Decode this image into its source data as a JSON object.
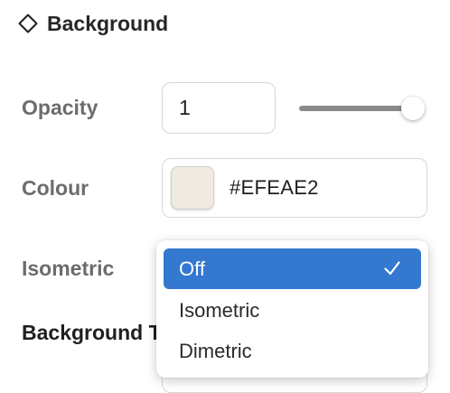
{
  "section": {
    "title": "Background",
    "icon": "diamond-outline-icon"
  },
  "opacity": {
    "label": "Opacity",
    "value": "1",
    "slider_fraction": 1.0
  },
  "colour": {
    "label": "Colour",
    "hex": "#EFEAE2",
    "swatch_color": "#EFEAE2"
  },
  "isometric": {
    "label": "Isometric",
    "selected": "Off",
    "options": [
      "Off",
      "Isometric",
      "Dimetric"
    ]
  },
  "background_type": {
    "label": "Background T"
  },
  "colors": {
    "accent": "#3478D0"
  }
}
